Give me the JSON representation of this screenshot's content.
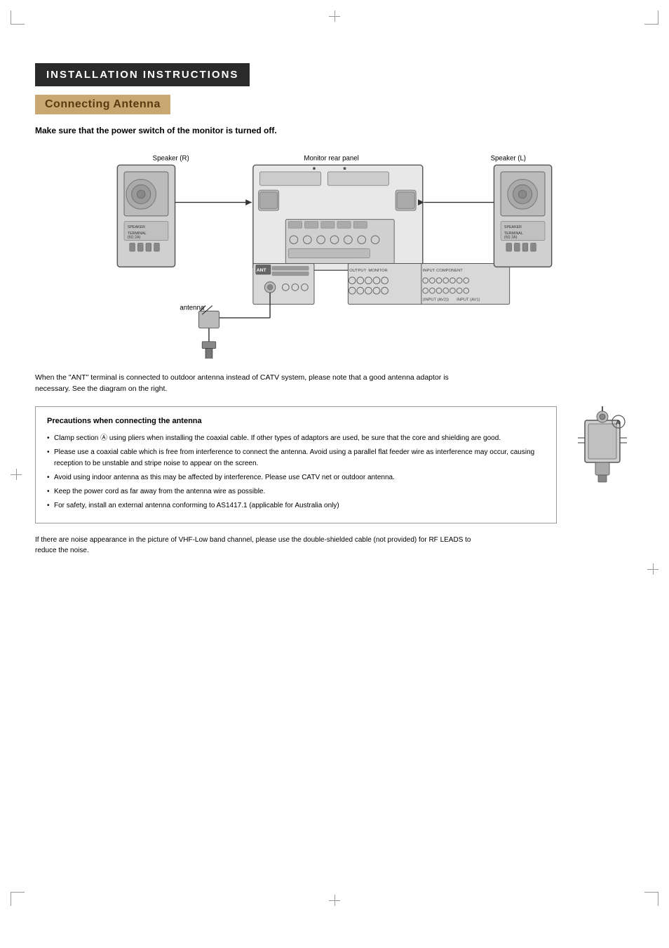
{
  "page": {
    "title": "INSTALLATION INSTRUCTIONS",
    "section": "Connecting Antenna",
    "subtitle": "Make sure that the power switch of the monitor is turned off.",
    "body_text": "When the \"ANT\" terminal is connected to outdoor antenna instead of CATV system, please note that a good antenna adaptor is necessary. See the diagram on the right.",
    "footer_text": "If there are noise appearance in the picture of VHF-Low band channel, please use the double-shielded cable (not provided) for RF LEADS to reduce the noise.",
    "diagram": {
      "speaker_r_label": "Speaker (R)",
      "speaker_l_label": "Speaker (L)",
      "monitor_rear_label": "Monitor rear panel",
      "antenna_label": "antenna"
    },
    "precautions": {
      "title": "Precautions when connecting the antenna",
      "items": [
        "Clamp section Ⓐ using pliers when installing the coaxial cable. If other types of adaptors are used, be sure that the core and shielding are good.",
        "Please use a coaxial cable which is free from interference to connect the antenna. Avoid using a parallel flat feeder wire as interference may occur, causing reception to be unstable and stripe noise to appear on the screen.",
        "Avoid using indoor antenna as this may be affected by interference. Please use CATV net or outdoor antenna.",
        "Keep the power cord as far away from the antenna wire as possible.",
        "For safety, install an external antenna conforming to AS1417.1 (applicable for Australia only)"
      ]
    }
  }
}
